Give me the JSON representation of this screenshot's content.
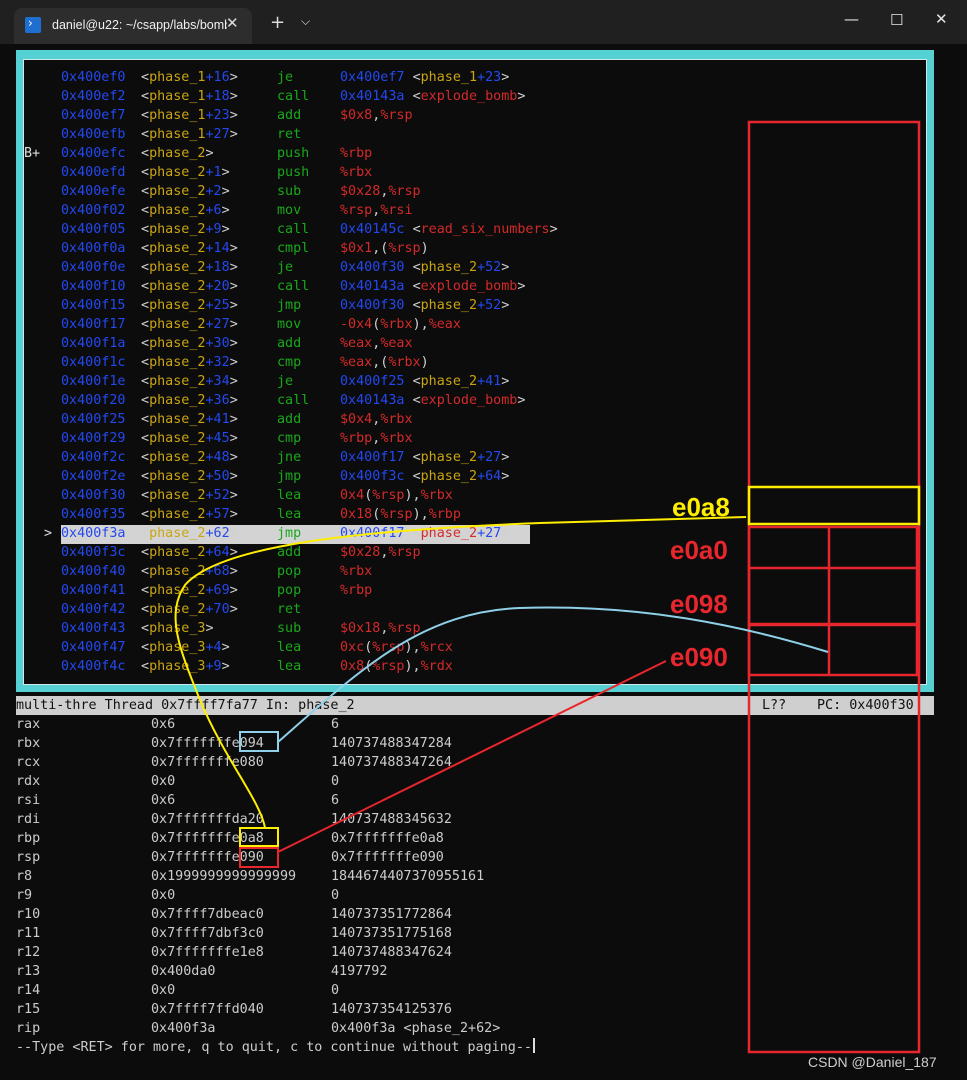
{
  "titlebar": {
    "tab_title": "daniel@u22: ~/csapp/labs/bomb",
    "tab_icon": "terminal-icon",
    "close_tab": "✕",
    "new_tab": "+",
    "dropdown": "⌵",
    "minimize": "—",
    "maximize": "☐",
    "close": "✕"
  },
  "asm": [
    {
      "marker": "",
      "addr": "0x400ef0",
      "label": [
        "phase_1",
        "+16"
      ],
      "mnem": "je",
      "ops": [
        [
          "0x400ef7 ",
          "b"
        ],
        [
          "<",
          "w"
        ],
        [
          "phase_1",
          "y"
        ],
        [
          "+23",
          "b"
        ],
        [
          ">",
          "w"
        ]
      ]
    },
    {
      "marker": "",
      "addr": "0x400ef2",
      "label": [
        "phase_1",
        "+18"
      ],
      "mnem": "call",
      "ops": [
        [
          "0x40143a ",
          "b"
        ],
        [
          "<",
          "w"
        ],
        [
          "explode_bomb",
          "r"
        ],
        [
          ">",
          "w"
        ]
      ]
    },
    {
      "marker": "",
      "addr": "0x400ef7",
      "label": [
        "phase_1",
        "+23"
      ],
      "mnem": "add",
      "ops": [
        [
          "$0x8",
          "r"
        ],
        [
          ",",
          "w"
        ],
        [
          "%rsp",
          "r"
        ]
      ]
    },
    {
      "marker": "",
      "addr": "0x400efb",
      "label": [
        "phase_1",
        "+27"
      ],
      "mnem": "ret",
      "ops": []
    },
    {
      "marker": "B+",
      "addr": "0x400efc",
      "label": [
        "phase_2",
        ""
      ],
      "mnem": "push",
      "ops": [
        [
          "%rbp",
          "r"
        ]
      ]
    },
    {
      "marker": "",
      "addr": "0x400efd",
      "label": [
        "phase_2",
        "+1"
      ],
      "mnem": "push",
      "ops": [
        [
          "%rbx",
          "r"
        ]
      ]
    },
    {
      "marker": "",
      "addr": "0x400efe",
      "label": [
        "phase_2",
        "+2"
      ],
      "mnem": "sub",
      "ops": [
        [
          "$0x28",
          "r"
        ],
        [
          ",",
          "w"
        ],
        [
          "%rsp",
          "r"
        ]
      ]
    },
    {
      "marker": "",
      "addr": "0x400f02",
      "label": [
        "phase_2",
        "+6"
      ],
      "mnem": "mov",
      "ops": [
        [
          "%rsp",
          "r"
        ],
        [
          ",",
          "w"
        ],
        [
          "%rsi",
          "r"
        ]
      ]
    },
    {
      "marker": "",
      "addr": "0x400f05",
      "label": [
        "phase_2",
        "+9"
      ],
      "mnem": "call",
      "ops": [
        [
          "0x40145c ",
          "b"
        ],
        [
          "<",
          "w"
        ],
        [
          "read_six_numbers",
          "r"
        ],
        [
          ">",
          "w"
        ]
      ]
    },
    {
      "marker": "",
      "addr": "0x400f0a",
      "label": [
        "phase_2",
        "+14"
      ],
      "mnem": "cmpl",
      "ops": [
        [
          "$0x1",
          "r"
        ],
        [
          ",(",
          "w"
        ],
        [
          "%rsp",
          "r"
        ],
        [
          ")",
          "w"
        ]
      ]
    },
    {
      "marker": "",
      "addr": "0x400f0e",
      "label": [
        "phase_2",
        "+18"
      ],
      "mnem": "je",
      "ops": [
        [
          "0x400f30 ",
          "b"
        ],
        [
          "<",
          "w"
        ],
        [
          "phase_2",
          "y"
        ],
        [
          "+52",
          "b"
        ],
        [
          ">",
          "w"
        ]
      ]
    },
    {
      "marker": "",
      "addr": "0x400f10",
      "label": [
        "phase_2",
        "+20"
      ],
      "mnem": "call",
      "ops": [
        [
          "0x40143a ",
          "b"
        ],
        [
          "<",
          "w"
        ],
        [
          "explode_bomb",
          "r"
        ],
        [
          ">",
          "w"
        ]
      ]
    },
    {
      "marker": "",
      "addr": "0x400f15",
      "label": [
        "phase_2",
        "+25"
      ],
      "mnem": "jmp",
      "ops": [
        [
          "0x400f30 ",
          "b"
        ],
        [
          "<",
          "w"
        ],
        [
          "phase_2",
          "y"
        ],
        [
          "+52",
          "b"
        ],
        [
          ">",
          "w"
        ]
      ]
    },
    {
      "marker": "",
      "addr": "0x400f17",
      "label": [
        "phase_2",
        "+27"
      ],
      "mnem": "mov",
      "ops": [
        [
          "-0x4",
          "r"
        ],
        [
          "(",
          "w"
        ],
        [
          "%rbx",
          "r"
        ],
        [
          "),",
          "w"
        ],
        [
          "%eax",
          "r"
        ]
      ]
    },
    {
      "marker": "",
      "addr": "0x400f1a",
      "label": [
        "phase_2",
        "+30"
      ],
      "mnem": "add",
      "ops": [
        [
          "%eax",
          "r"
        ],
        [
          ",",
          "w"
        ],
        [
          "%eax",
          "r"
        ]
      ]
    },
    {
      "marker": "",
      "addr": "0x400f1c",
      "label": [
        "phase_2",
        "+32"
      ],
      "mnem": "cmp",
      "ops": [
        [
          "%eax",
          "r"
        ],
        [
          ",(",
          "w"
        ],
        [
          "%rbx",
          "r"
        ],
        [
          ")",
          "w"
        ]
      ]
    },
    {
      "marker": "",
      "addr": "0x400f1e",
      "label": [
        "phase_2",
        "+34"
      ],
      "mnem": "je",
      "ops": [
        [
          "0x400f25 ",
          "b"
        ],
        [
          "<",
          "w"
        ],
        [
          "phase_2",
          "y"
        ],
        [
          "+41",
          "b"
        ],
        [
          ">",
          "w"
        ]
      ]
    },
    {
      "marker": "",
      "addr": "0x400f20",
      "label": [
        "phase_2",
        "+36"
      ],
      "mnem": "call",
      "ops": [
        [
          "0x40143a ",
          "b"
        ],
        [
          "<",
          "w"
        ],
        [
          "explode_bomb",
          "r"
        ],
        [
          ">",
          "w"
        ]
      ]
    },
    {
      "marker": "",
      "addr": "0x400f25",
      "label": [
        "phase_2",
        "+41"
      ],
      "mnem": "add",
      "ops": [
        [
          "$0x4",
          "r"
        ],
        [
          ",",
          "w"
        ],
        [
          "%rbx",
          "r"
        ]
      ]
    },
    {
      "marker": "",
      "addr": "0x400f29",
      "label": [
        "phase_2",
        "+45"
      ],
      "mnem": "cmp",
      "ops": [
        [
          "%rbp",
          "r"
        ],
        [
          ",",
          "w"
        ],
        [
          "%rbx",
          "r"
        ]
      ]
    },
    {
      "marker": "",
      "addr": "0x400f2c",
      "label": [
        "phase_2",
        "+48"
      ],
      "mnem": "jne",
      "ops": [
        [
          "0x400f17 ",
          "b"
        ],
        [
          "<",
          "w"
        ],
        [
          "phase_2",
          "y"
        ],
        [
          "+27",
          "b"
        ],
        [
          ">",
          "w"
        ]
      ]
    },
    {
      "marker": "",
      "addr": "0x400f2e",
      "label": [
        "phase_2",
        "+50"
      ],
      "mnem": "jmp",
      "ops": [
        [
          "0x400f3c ",
          "b"
        ],
        [
          "<",
          "w"
        ],
        [
          "phase_2",
          "y"
        ],
        [
          "+64",
          "b"
        ],
        [
          ">",
          "w"
        ]
      ]
    },
    {
      "marker": "",
      "addr": "0x400f30",
      "label": [
        "phase_2",
        "+52"
      ],
      "mnem": "lea",
      "ops": [
        [
          "0x4",
          "r"
        ],
        [
          "(",
          "w"
        ],
        [
          "%rsp",
          "r"
        ],
        [
          "),",
          "w"
        ],
        [
          "%rbx",
          "r"
        ]
      ]
    },
    {
      "marker": "",
      "addr": "0x400f35",
      "label": [
        "phase_2",
        "+57"
      ],
      "mnem": "lea",
      "ops": [
        [
          "0x18",
          "r"
        ],
        [
          "(",
          "w"
        ],
        [
          "%rsp",
          "r"
        ],
        [
          "),",
          "w"
        ],
        [
          "%rbp",
          "r"
        ]
      ]
    },
    {
      "marker": ">",
      "addr": "0x400f3a",
      "label": [
        "phase_2",
        "+62"
      ],
      "mnem": "jmp",
      "ops": [
        [
          "0x400f17 ",
          "b"
        ],
        [
          "<",
          "w"
        ],
        [
          "phase_2",
          "r"
        ],
        [
          "+27",
          "b"
        ],
        [
          ">",
          "w"
        ]
      ],
      "current": true
    },
    {
      "marker": "",
      "addr": "0x400f3c",
      "label": [
        "phase_2",
        "+64"
      ],
      "mnem": "add",
      "ops": [
        [
          "$0x28",
          "r"
        ],
        [
          ",",
          "w"
        ],
        [
          "%rsp",
          "r"
        ]
      ]
    },
    {
      "marker": "",
      "addr": "0x400f40",
      "label": [
        "phase_2",
        "+68"
      ],
      "mnem": "pop",
      "ops": [
        [
          "%rbx",
          "r"
        ]
      ]
    },
    {
      "marker": "",
      "addr": "0x400f41",
      "label": [
        "phase_2",
        "+69"
      ],
      "mnem": "pop",
      "ops": [
        [
          "%rbp",
          "r"
        ]
      ]
    },
    {
      "marker": "",
      "addr": "0x400f42",
      "label": [
        "phase_2",
        "+70"
      ],
      "mnem": "ret",
      "ops": []
    },
    {
      "marker": "",
      "addr": "0x400f43",
      "label": [
        "phase_3",
        ""
      ],
      "mnem": "sub",
      "ops": [
        [
          "$0x18",
          "r"
        ],
        [
          ",",
          "w"
        ],
        [
          "%rsp",
          "r"
        ]
      ]
    },
    {
      "marker": "",
      "addr": "0x400f47",
      "label": [
        "phase_3",
        "+4"
      ],
      "mnem": "lea",
      "ops": [
        [
          "0xc",
          "r"
        ],
        [
          "(",
          "w"
        ],
        [
          "%rsp",
          "r"
        ],
        [
          "),",
          "w"
        ],
        [
          "%rcx",
          "r"
        ]
      ]
    },
    {
      "marker": "",
      "addr": "0x400f4c",
      "label": [
        "phase_3",
        "+9"
      ],
      "mnem": "lea",
      "ops": [
        [
          "0x8",
          "r"
        ],
        [
          "(",
          "w"
        ],
        [
          "%rsp",
          "r"
        ],
        [
          "),",
          "w"
        ],
        [
          "%rdx",
          "r"
        ]
      ]
    }
  ],
  "status": {
    "left": "multi-thre Thread 0x7ffff7fa77 In: phase_2",
    "line": "L??",
    "pc": "PC: 0x400f30"
  },
  "registers": [
    {
      "name": "rax",
      "hex": "0x6",
      "dec": "6"
    },
    {
      "name": "rbx",
      "hex": "0x7fffffffe094",
      "dec": "140737488347284"
    },
    {
      "name": "rcx",
      "hex": "0x7fffffffe080",
      "dec": "140737488347264"
    },
    {
      "name": "rdx",
      "hex": "0x0",
      "dec": "0"
    },
    {
      "name": "rsi",
      "hex": "0x6",
      "dec": "6"
    },
    {
      "name": "rdi",
      "hex": "0x7fffffffda20",
      "dec": "140737488345632"
    },
    {
      "name": "rbp",
      "hex": "0x7fffffffe0a8",
      "dec": "0x7fffffffe0a8"
    },
    {
      "name": "rsp",
      "hex": "0x7fffffffe090",
      "dec": "0x7fffffffe090"
    },
    {
      "name": "r8",
      "hex": "0x1999999999999999",
      "dec": "1844674407370955161"
    },
    {
      "name": "r9",
      "hex": "0x0",
      "dec": "0"
    },
    {
      "name": "r10",
      "hex": "0x7ffff7dbeac0",
      "dec": "140737351772864"
    },
    {
      "name": "r11",
      "hex": "0x7ffff7dbf3c0",
      "dec": "140737351775168"
    },
    {
      "name": "r12",
      "hex": "0x7fffffffe1e8",
      "dec": "140737488347624"
    },
    {
      "name": "r13",
      "hex": "0x400da0",
      "dec": "4197792"
    },
    {
      "name": "r14",
      "hex": "0x0",
      "dec": "0"
    },
    {
      "name": "r15",
      "hex": "0x7ffff7ffd040",
      "dec": "140737354125376"
    },
    {
      "name": "rip",
      "hex": "0x400f3a",
      "dec": "0x400f3a <phase_2+62>"
    }
  ],
  "prompt": "--Type <RET> for more, q to quit, c to continue without paging--",
  "annotations": {
    "e0a8": "e0a8",
    "e0a0": "e0a0",
    "e098": "e098",
    "e090": "e090",
    "yellow": "#ffee00",
    "red": "#e8262d",
    "blue": "#8fd0e8"
  },
  "watermark": "CSDN @Daniel_187",
  "colors": {
    "tui_frame": "#55d0d3",
    "address": "#2448f0",
    "mnemonic": "#19a81b",
    "symbol": "#c9a514",
    "operand": "#d32a2a"
  }
}
